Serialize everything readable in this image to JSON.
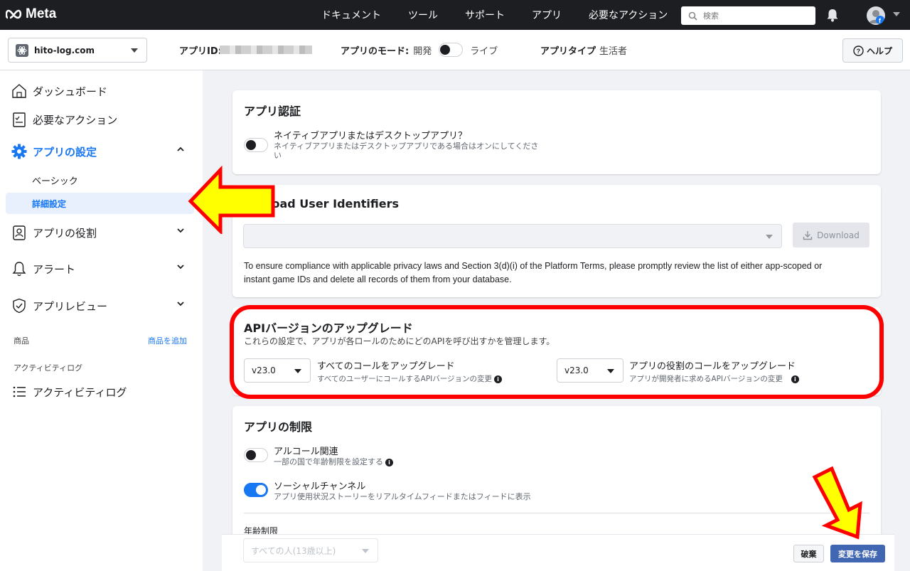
{
  "topnav": {
    "logo": "Meta",
    "items": [
      "ドキュメント",
      "ツール",
      "サポート",
      "アプリ",
      "必要なアクション"
    ],
    "search_placeholder": "検索"
  },
  "subheader": {
    "app_name": "hito-log.com",
    "app_id_label": "アプリID:",
    "app_mode_label": "アプリのモード:",
    "mode_dev": "開発",
    "mode_live": "ライブ",
    "app_type_label": "アプリタイプ",
    "app_type_value": "生活者",
    "help_label": "ヘルプ"
  },
  "sidebar": {
    "dashboard": "ダッシュボード",
    "required_actions": "必要なアクション",
    "app_settings": "アプリの設定",
    "basic": "ベーシック",
    "advanced": "詳細設定",
    "app_roles": "アプリの役割",
    "alerts": "アラート",
    "app_review": "アプリレビュー",
    "products": "商品",
    "add_product": "商品を追加",
    "activity_log_section": "アクティビティログ",
    "activity_log": "アクティビティログ"
  },
  "auth_card": {
    "title": "アプリ認証",
    "toggle_label": "ネイティブアプリまたはデスクトップアプリ？",
    "toggle_desc": "ネイティブアプリまたはデスクトップアプリである場合はオンにしてくださ",
    "toggle_desc_2": "い"
  },
  "download_card": {
    "title": "Download User Identifiers",
    "title_visible": "load User Identifiers",
    "button": "Download",
    "note": "To ensure compliance with applicable privacy laws and Section 3(d)(i) of the Platform Terms, please promptly review the list of either app-scoped or",
    "note_2": "instant game IDs and delete all records of them from your database."
  },
  "api_card": {
    "title": "APIバージョンのアップグレード",
    "desc": "これらの設定で、アプリが各ロールのためにどのAPIを呼び出すかを管理します。",
    "left_version": "v23.0",
    "left_title": "すべてのコールをアップグレード",
    "left_desc": "すべてのユーザーにコールするAPIバージョンの変更",
    "right_version": "v23.0",
    "right_title": "アプリの役割のコールをアップグレード",
    "right_desc": "アプリが開発者に求めるAPIバージョンの変更"
  },
  "restrict_card": {
    "title": "アプリの制限",
    "alcohol_label": "アルコール関連",
    "alcohol_desc": "一部の国で年齢制限を設定する",
    "social_label": "ソーシャルチャンネル",
    "social_desc": "アプリ使用状況ストーリーをリアルタイムフィードまたはフィードに表示",
    "age_label": "年齢制限",
    "age_value": "すべての人(13歳以上)"
  },
  "footer": {
    "discard": "破棄",
    "save": "変更を保存"
  },
  "colors": {
    "accent": "#1877f2",
    "annotation_red": "#ff0000",
    "annotation_yellow": "#ffff00"
  }
}
